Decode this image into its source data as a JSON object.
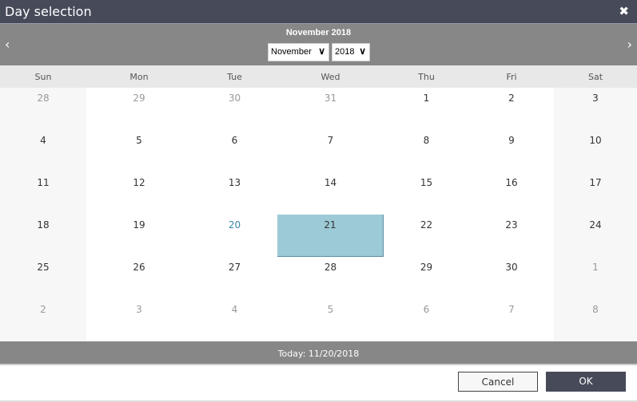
{
  "dialog": {
    "title": "Day selection",
    "close_icon": "close-icon"
  },
  "nav": {
    "heading": "November 2018",
    "month_select": "November",
    "year_select": "2018"
  },
  "day_names": [
    "Sun",
    "Mon",
    "Tue",
    "Wed",
    "Thu",
    "Fri",
    "Sat"
  ],
  "weeks": [
    [
      {
        "d": "28",
        "o": true
      },
      {
        "d": "29",
        "o": true
      },
      {
        "d": "30",
        "o": true
      },
      {
        "d": "31",
        "o": true
      },
      {
        "d": "1"
      },
      {
        "d": "2"
      },
      {
        "d": "3"
      }
    ],
    [
      {
        "d": "4"
      },
      {
        "d": "5"
      },
      {
        "d": "6"
      },
      {
        "d": "7"
      },
      {
        "d": "8"
      },
      {
        "d": "9"
      },
      {
        "d": "10"
      }
    ],
    [
      {
        "d": "11"
      },
      {
        "d": "12"
      },
      {
        "d": "13"
      },
      {
        "d": "14"
      },
      {
        "d": "15"
      },
      {
        "d": "16"
      },
      {
        "d": "17"
      }
    ],
    [
      {
        "d": "18"
      },
      {
        "d": "19"
      },
      {
        "d": "20",
        "today": true
      },
      {
        "d": "21",
        "selected": true
      },
      {
        "d": "22"
      },
      {
        "d": "23"
      },
      {
        "d": "24"
      }
    ],
    [
      {
        "d": "25"
      },
      {
        "d": "26"
      },
      {
        "d": "27"
      },
      {
        "d": "28"
      },
      {
        "d": "29"
      },
      {
        "d": "30"
      },
      {
        "d": "1",
        "o": true
      }
    ],
    [
      {
        "d": "2",
        "o": true
      },
      {
        "d": "3",
        "o": true
      },
      {
        "d": "4",
        "o": true
      },
      {
        "d": "5",
        "o": true
      },
      {
        "d": "6",
        "o": true
      },
      {
        "d": "7",
        "o": true
      },
      {
        "d": "8",
        "o": true
      }
    ]
  ],
  "footer": {
    "today": "Today: 11/20/2018"
  },
  "buttons": {
    "cancel": "Cancel",
    "ok": "OK"
  },
  "colors": {
    "titlebar": "#474a59",
    "selected": "#9ccad6",
    "today": "#3a86a8"
  }
}
